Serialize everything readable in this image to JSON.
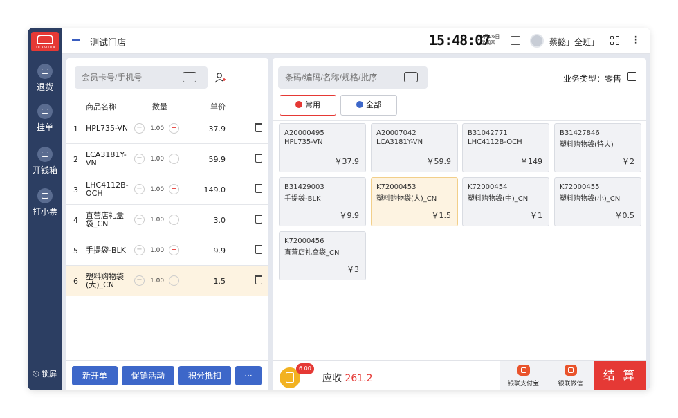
{
  "brand": {
    "logo_text": "LOCK&LOCK"
  },
  "header": {
    "store_name": "测试门店",
    "time": "15:48:07",
    "date_line1": "9月26日",
    "date_line2": "星期四",
    "user": "蔡懿」全班」"
  },
  "sidebar": {
    "items": [
      {
        "label": "退货",
        "icon": "return-icon"
      },
      {
        "label": "挂单",
        "icon": "hold-order-icon"
      },
      {
        "label": "开钱箱",
        "icon": "cash-drawer-icon"
      },
      {
        "label": "打小票",
        "icon": "print-receipt-icon"
      }
    ],
    "lock_label": "锁屏"
  },
  "cart": {
    "member_placeholder": "会员卡号/手机号",
    "headers": {
      "name": "商品名称",
      "qty": "数量",
      "price": "单价"
    },
    "rows": [
      {
        "idx": "1",
        "name": "HPL735-VN",
        "qty": "1.00",
        "price": "37.9"
      },
      {
        "idx": "2",
        "name": "LCA3181Y-VN",
        "qty": "1.00",
        "price": "59.9"
      },
      {
        "idx": "3",
        "name": "LHC4112B-OCH",
        "qty": "1.00",
        "price": "149.0"
      },
      {
        "idx": "4",
        "name": "直营店礼盒袋_CN",
        "qty": "1.00",
        "price": "3.0"
      },
      {
        "idx": "5",
        "name": "手提袋-BLK",
        "qty": "1.00",
        "price": "9.9"
      },
      {
        "idx": "6",
        "name": "塑料购物袋(大)_CN",
        "qty": "1.00",
        "price": "1.5"
      }
    ],
    "footer_buttons": [
      "新开单",
      "促销活动",
      "积分抵扣",
      "···"
    ]
  },
  "products": {
    "search_placeholder": "条码/编码/名称/规格/批序",
    "business_type": "业务类型：零售",
    "tabs": [
      {
        "label": "常用",
        "active": true
      },
      {
        "label": "全部",
        "active": false
      }
    ],
    "items": [
      {
        "code": "A20000495",
        "name": "HPL735-VN",
        "price": "￥37.9"
      },
      {
        "code": "A20007042",
        "name": "LCA3181Y-VN",
        "price": "￥59.9"
      },
      {
        "code": "B31042771",
        "name": "LHC4112B-OCH",
        "price": "￥149"
      },
      {
        "code": "B31427846",
        "name": "塑料购物袋(特大)",
        "price": "￥2"
      },
      {
        "code": "B31429003",
        "name": "手提袋-BLK",
        "price": "￥9.9"
      },
      {
        "code": "K72000453",
        "name": "塑料购物袋(大)_CN",
        "price": "￥1.5",
        "highlight": true
      },
      {
        "code": "K72000454",
        "name": "塑料购物袋(中)_CN",
        "price": "￥1"
      },
      {
        "code": "K72000455",
        "name": "塑料购物袋(小)_CN",
        "price": "￥0.5"
      },
      {
        "code": "K72000456",
        "name": "直营店礼盒袋_CN",
        "price": "￥3"
      }
    ]
  },
  "payment": {
    "badge": "6.00",
    "due_label": "应收",
    "due_amount": "261.2",
    "methods": [
      "银联支付宝",
      "银联微信"
    ],
    "checkout": "结 算"
  },
  "colors": {
    "sidebar": "#2c3e62",
    "accent_red": "#e53935",
    "button_blue": "#3d67c9",
    "selected_row": "#fdf3e1"
  }
}
